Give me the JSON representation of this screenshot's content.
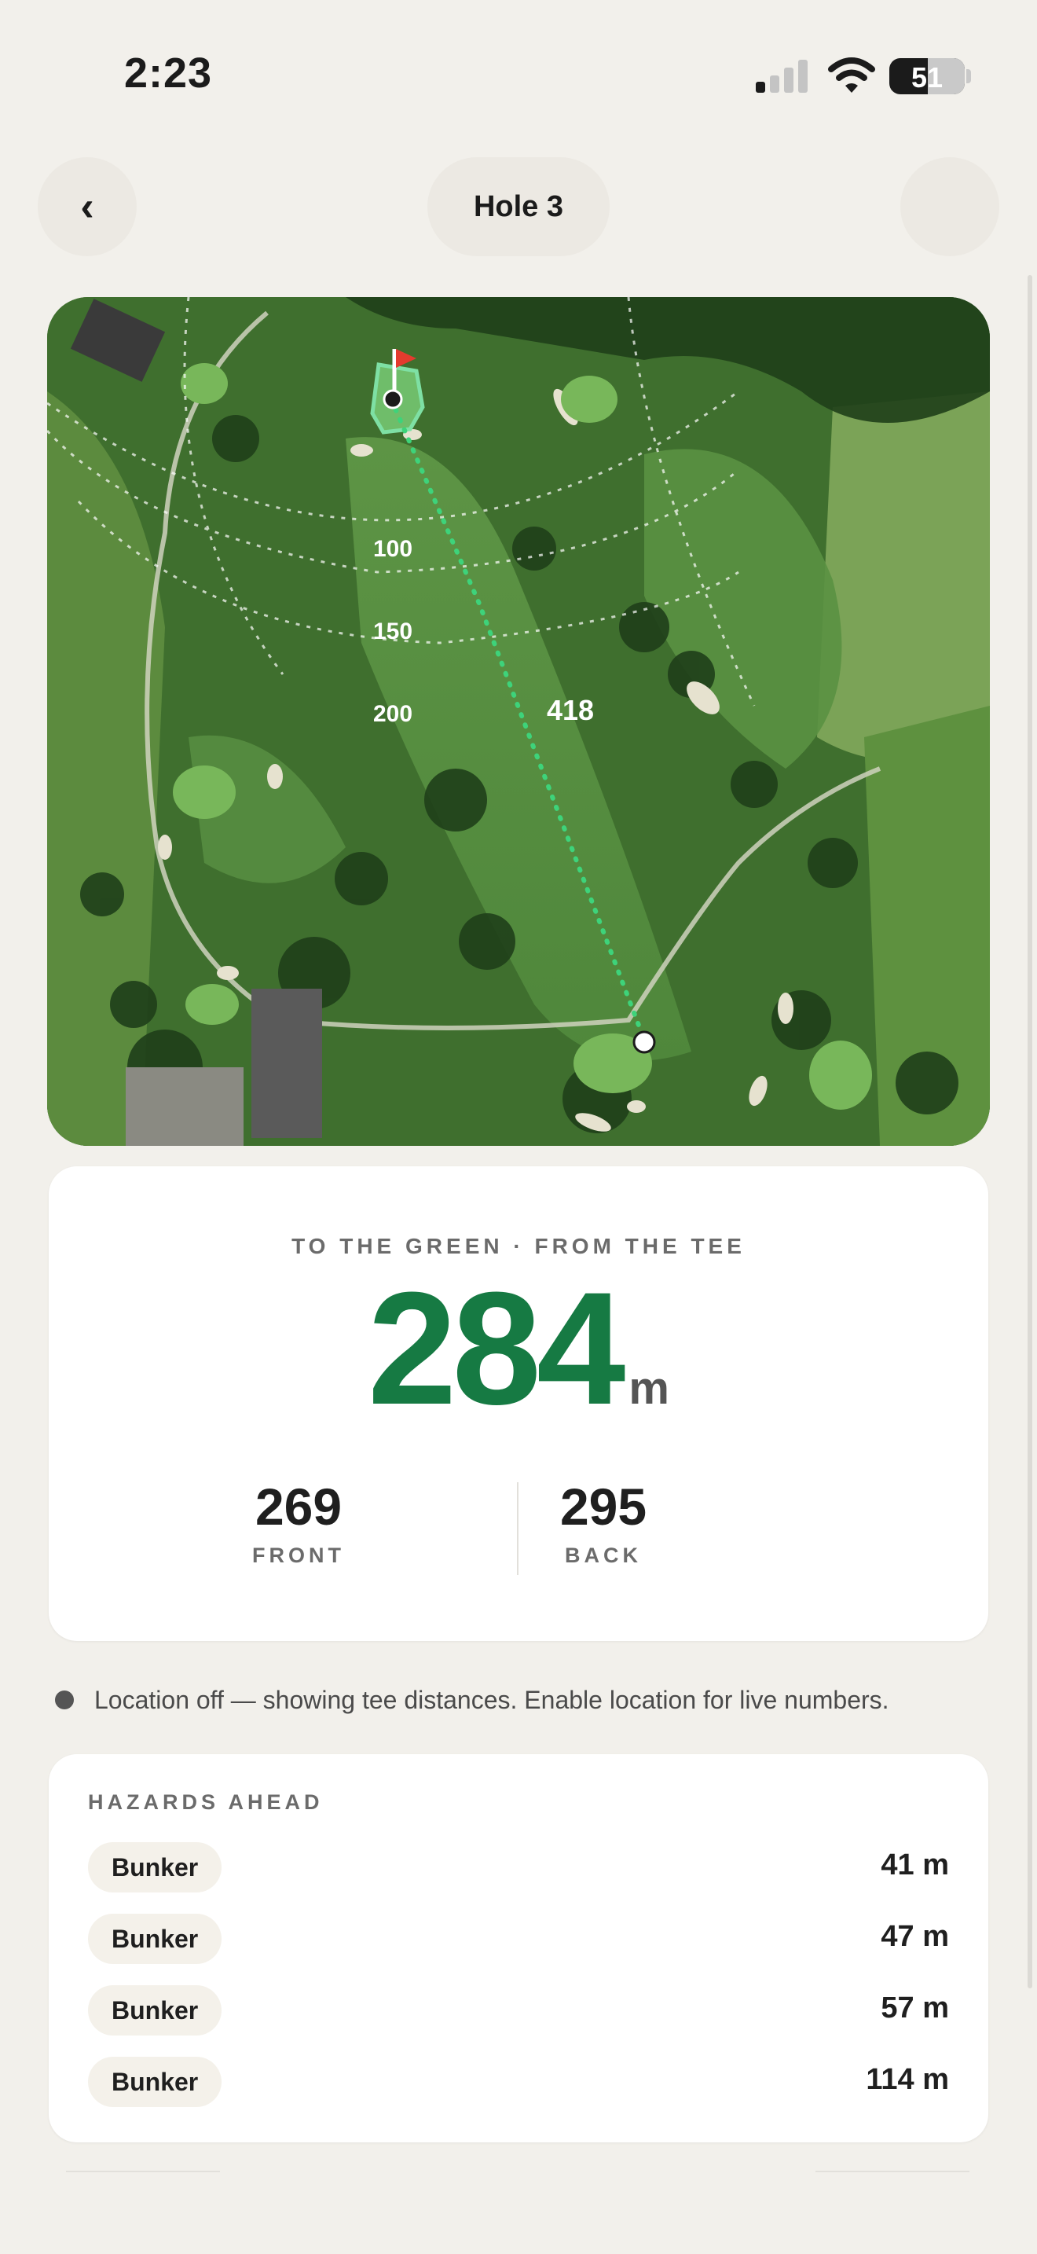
{
  "status_bar": {
    "time": "2:23",
    "battery": "51",
    "battery_level": 0.51
  },
  "nav": {
    "back_icon": "chevron-left-icon",
    "back_glyph": "‹",
    "title": "Hole 3"
  },
  "map": {
    "ring_labels": [
      "100",
      "150",
      "200"
    ],
    "hole_length_label": "418",
    "colors": {
      "route": "#3ed37a",
      "green_outline": "#7ee0a4",
      "flag": "#e33b2e"
    }
  },
  "distance": {
    "caption": "TO THE GREEN · FROM THE TEE",
    "center": "284",
    "unit": "m",
    "front": {
      "value": "269",
      "label": "FRONT"
    },
    "back": {
      "value": "295",
      "label": "BACK"
    }
  },
  "notice": {
    "text": "Location off — showing tee distances. Enable location for live numbers."
  },
  "hazards": {
    "title": "HAZARDS AHEAD",
    "items": [
      {
        "type": "Bunker",
        "distance": "41 m"
      },
      {
        "type": "Bunker",
        "distance": "47 m"
      },
      {
        "type": "Bunker",
        "distance": "57 m"
      },
      {
        "type": "Bunker",
        "distance": "114 m"
      }
    ]
  },
  "colors": {
    "accent": "#167a43",
    "background": "#f2f0eb"
  }
}
